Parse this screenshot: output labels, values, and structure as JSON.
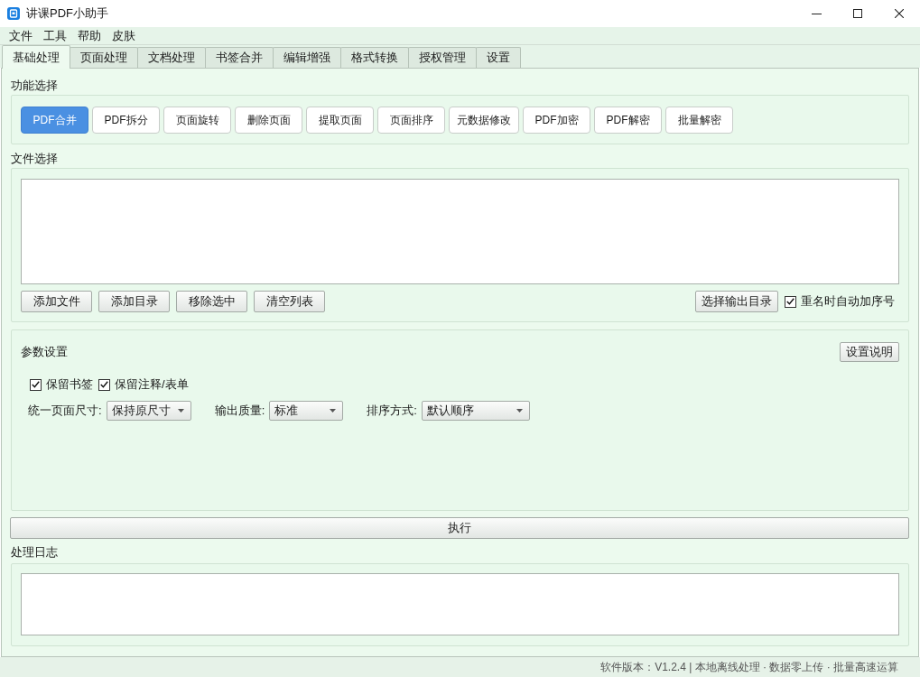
{
  "window": {
    "title": "讲课PDF小助手"
  },
  "menu": [
    "文件",
    "工具",
    "帮助",
    "皮肤"
  ],
  "tabs": [
    {
      "label": "基础处理",
      "selected": true
    },
    {
      "label": "页面处理",
      "selected": false
    },
    {
      "label": "文档处理",
      "selected": false
    },
    {
      "label": "书签合并",
      "selected": false
    },
    {
      "label": "编辑增强",
      "selected": false
    },
    {
      "label": "格式转换",
      "selected": false
    },
    {
      "label": "授权管理",
      "selected": false
    },
    {
      "label": "设置",
      "selected": false
    }
  ],
  "function_select": {
    "label": "功能选择",
    "buttons": [
      {
        "label": "PDF合并",
        "selected": true
      },
      {
        "label": "PDF拆分",
        "selected": false
      },
      {
        "label": "页面旋转",
        "selected": false
      },
      {
        "label": "删除页面",
        "selected": false
      },
      {
        "label": "提取页面",
        "selected": false
      },
      {
        "label": "页面排序",
        "selected": false
      },
      {
        "label": "元数据修改",
        "selected": false
      },
      {
        "label": "PDF加密",
        "selected": false
      },
      {
        "label": "PDF解密",
        "selected": false
      },
      {
        "label": "批量解密",
        "selected": false
      }
    ]
  },
  "file_select": {
    "label": "文件选择",
    "buttons": [
      "添加文件",
      "添加目录",
      "移除选中",
      "清空列表"
    ],
    "output_button": "选择输出目录",
    "auto_number": {
      "label": "重名时自动加序号",
      "checked": true
    }
  },
  "params": {
    "label": "参数设置",
    "help_button": "设置说明",
    "options": [
      {
        "label": "保留书签",
        "checked": true
      },
      {
        "label": "保留注释/表单",
        "checked": true
      }
    ],
    "selects": [
      {
        "label": "统一页面尺寸:",
        "value": "保持原尺寸"
      },
      {
        "label": "输出质量:",
        "value": "标准"
      },
      {
        "label": "排序方式:",
        "value": "默认顺序"
      }
    ]
  },
  "execute_button": "执行",
  "log": {
    "label": "处理日志"
  },
  "status_bar": "软件版本：V1.2.4 | 本地离线处理 · 数据零上传 · 批量高速运算"
}
